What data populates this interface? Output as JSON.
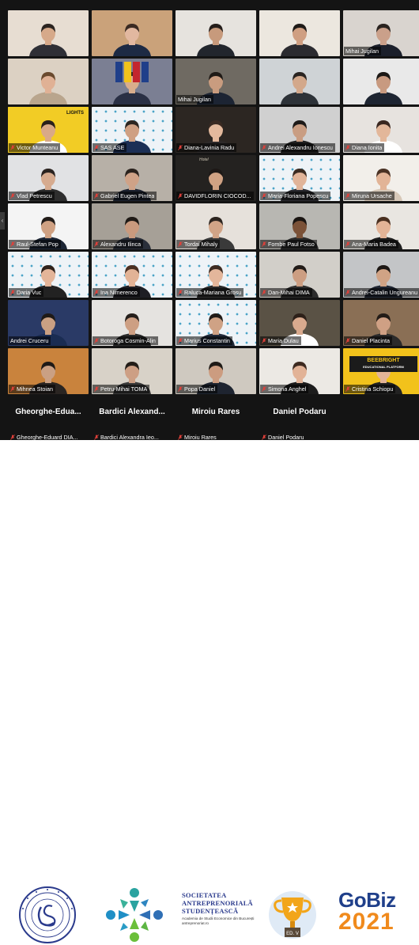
{
  "participants": [
    {
      "label": "",
      "bg": "#e7ddd2",
      "skin": "#d6a98a",
      "hair": "#2b2420",
      "shirt": "#2f2f36",
      "muted": false
    },
    {
      "label": "",
      "bg": "#caa27a",
      "skin": "#e2b8a0",
      "hair": "#3a2a22",
      "shirt": "#1d2a44",
      "muted": false
    },
    {
      "label": "",
      "bg": "#e6e3de",
      "skin": "#c79a7c",
      "hair": "#241d1a",
      "shirt": "#22262d",
      "muted": false
    },
    {
      "label": "",
      "bg": "#ece7df",
      "skin": "#cf9f82",
      "hair": "#1e1a17",
      "shirt": "#2b2b30",
      "muted": false
    },
    {
      "label": "Mihai Jugilan",
      "bg": "#d9d4cf",
      "skin": "#caa08a",
      "hair": "#2a2320",
      "shirt": "#1b1f2b",
      "muted": false
    },
    {
      "label": "",
      "bg": "#dcd1c3",
      "skin": "#e0b195",
      "hair": "#6a4a2e",
      "shirt": "#b9a58d",
      "muted": false
    },
    {
      "label": "",
      "bg": "#7b7f93",
      "skin": "#d9ad8c",
      "hair": "#3d2e23",
      "shirt": "#2a3045",
      "muted": false,
      "flags": true
    },
    {
      "label": "Mihai Jugilan",
      "bg": "#6f6a62",
      "skin": "#c99c7f",
      "hair": "#1f1a16",
      "shirt": "#1c2433",
      "muted": false
    },
    {
      "label": "",
      "bg": "#cfd3d6",
      "skin": "#d3a88b",
      "hair": "#2a2421",
      "shirt": "#2d3238",
      "muted": false
    },
    {
      "label": "",
      "bg": "#e9e9e9",
      "skin": "#c89a80",
      "hair": "#1b1815",
      "shirt": "#1e2532",
      "muted": false
    },
    {
      "label": "Victor Munteanu",
      "bg": "#f2cc25",
      "skin": "#d9a987",
      "hair": "#2a211b",
      "shirt": "#ffffff",
      "muted": true,
      "speaking": true
    },
    {
      "label": "SAS ASE",
      "bg": "#eef3f7",
      "skin": "#cfa083",
      "hair": "#2d2621",
      "shirt": "#1c2f55",
      "muted": true,
      "pattern": true
    },
    {
      "label": "Diana-Lavinia Radu",
      "bg": "#2c2622",
      "skin": "#e4b99d",
      "hair": "#3a2a22",
      "shirt": "#2e2a2a",
      "muted": true
    },
    {
      "label": "Andrei Alexandru Ionescu",
      "bg": "#d0d0d0",
      "skin": "#c99d82",
      "hair": "#1d1a18",
      "shirt": "#202020",
      "muted": true
    },
    {
      "label": "Diana Ionita",
      "bg": "#e7e3df",
      "skin": "#e3b79a",
      "hair": "#3a2720",
      "shirt": "#ffffff",
      "muted": true
    },
    {
      "label": "Vlad Petrescu",
      "bg": "#e1e2e4",
      "skin": "#d6ab8f",
      "hair": "#2a2320",
      "shirt": "#2e2e2e",
      "muted": true
    },
    {
      "label": "Gabriel Eugen Pintea",
      "bg": "#b7b0a7",
      "skin": "#cfa287",
      "hair": "#2a221d",
      "shirt": "#1c2230",
      "muted": true
    },
    {
      "label": "DAVIDFLORIN CIOCOD...",
      "bg": "#242220",
      "skin": "#d0a283",
      "hair": "#1d1816",
      "shirt": "#222222",
      "muted": true
    },
    {
      "label": "Maria-Floriana Popescu",
      "bg": "#eef3f7",
      "skin": "#e1b499",
      "hair": "#3b2b22",
      "shirt": "#2a2a30",
      "muted": true,
      "pattern": true
    },
    {
      "label": "Miruna Ursache",
      "bg": "#f2efea",
      "skin": "#e2b497",
      "hair": "#4a3224",
      "shirt": "#d7c8b8",
      "muted": true
    },
    {
      "label": "Raul-Stefan Pop",
      "bg": "#f4f4f4",
      "skin": "#cfa183",
      "hair": "#221c19",
      "shirt": "#1c2534",
      "muted": true
    },
    {
      "label": "Alexandru Ilinca",
      "bg": "#a6a097",
      "skin": "#c99a7e",
      "hair": "#1f1a16",
      "shirt": "#2a2f3a",
      "muted": true
    },
    {
      "label": "Tordai Mihaly",
      "bg": "#e6e1db",
      "skin": "#d1a487",
      "hair": "#2c241f",
      "shirt": "#3a3a3a",
      "muted": true
    },
    {
      "label": "Fombe Paul Fotso",
      "bg": "#b8b7b2",
      "skin": "#7b5238",
      "hair": "#1a1512",
      "shirt": "#2b2b2b",
      "muted": true
    },
    {
      "label": "Ana-Maria Badea",
      "bg": "#e9e6e1",
      "skin": "#e3b497",
      "hair": "#4a3020",
      "shirt": "#1f1f1f",
      "muted": true
    },
    {
      "label": "Daria Vuc",
      "bg": "#eef3f7",
      "skin": "#e3b599",
      "hair": "#2f221b",
      "shirt": "#222222",
      "muted": true,
      "pattern": true
    },
    {
      "label": "Ina Nimerenco",
      "bg": "#eef3f7",
      "skin": "#e2b396",
      "hair": "#4a3022",
      "shirt": "#1e1e24",
      "muted": true,
      "pattern": true
    },
    {
      "label": "Raluca-Mariana Grosu",
      "bg": "#eef3f7",
      "skin": "#e3b69b",
      "hair": "#3d2b21",
      "shirt": "#2a2a2a",
      "muted": true,
      "pattern": true
    },
    {
      "label": "Dan-Mihai DIMA",
      "bg": "#d2cfc9",
      "skin": "#cc9e82",
      "hair": "#221c18",
      "shirt": "#2c2c2c",
      "muted": true
    },
    {
      "label": "Andrei-Catalin Ungureanu",
      "bg": "#c3c5c7",
      "skin": "#d0a385",
      "hair": "#1d1815",
      "shirt": "#1f2633",
      "muted": true
    },
    {
      "label": "Andrei Cruceru",
      "bg": "#2a3a66",
      "skin": "#caa083",
      "hair": "#1f1a17",
      "shirt": "#1a2c52",
      "muted": false
    },
    {
      "label": "Botoroga Cosmin-Alin",
      "bg": "#e5e3e0",
      "skin": "#cd9f83",
      "hair": "#251f1b",
      "shirt": "#2a2a2a",
      "muted": true
    },
    {
      "label": "Marius Constantin",
      "bg": "#eef3f7",
      "skin": "#cfa285",
      "hair": "#211b18",
      "shirt": "#222a3a",
      "muted": true,
      "pattern": true
    },
    {
      "label": "Maria Dulau",
      "bg": "#5a5245",
      "skin": "#d9aa8e",
      "hair": "#2d2019",
      "shirt": "#ffffff",
      "muted": true
    },
    {
      "label": "Daniel Placinta",
      "bg": "#8a6f55",
      "skin": "#cfa084",
      "hair": "#231c17",
      "shirt": "#2b2b2b",
      "muted": true
    },
    {
      "label": "Mihnea Stoian",
      "bg": "#c9833d",
      "skin": "#caa083",
      "hair": "#1f1a16",
      "shirt": "#2a2522",
      "muted": true
    },
    {
      "label": "Petru-Mihai TOMA",
      "bg": "#d8d2c8",
      "skin": "#cd9f84",
      "hair": "#231d18",
      "shirt": "#3a3a3a",
      "muted": true
    },
    {
      "label": "Popa Daniel",
      "bg": "#cfc9c0",
      "skin": "#cc9c80",
      "hair": "#1f1a16",
      "shirt": "#1e2430",
      "muted": true
    },
    {
      "label": "Simona Anghel",
      "bg": "#ece9e4",
      "skin": "#e2b397",
      "hair": "#3d2a20",
      "shirt": "#1c1c1c",
      "muted": true
    },
    {
      "label": "Cristina Schiopu",
      "bg": "#f2c21b",
      "skin": "#e3b497",
      "hair": "#3a281f",
      "shirt": "#222222",
      "muted": true,
      "beebright": true
    }
  ],
  "name_tiles": [
    {
      "big": "Gheorghe-Edua...",
      "label": "Gheorghe-Eduard DIA..."
    },
    {
      "big": "Bardici Alexand...",
      "label": "Bardici Alexandra Ieo..."
    },
    {
      "big": "Miroiu Rares",
      "label": "Miroiu Rares"
    },
    {
      "big": "Daniel Podaru",
      "label": "Daniel Podaru"
    }
  ],
  "overlay_text": {
    "lights_sign": "LIGHTS",
    "hotel_sign": "Hotel",
    "beebright": "BEEBRIGHT",
    "beebright_sub": "EDUCATIONAL PLATFORM"
  },
  "logos": {
    "ssa_line1": "SOCIETATEA",
    "ssa_line2": "ANTREPRENORIALĂ",
    "ssa_line3": "STUDENȚEASCĂ",
    "ssa_small": "Academia de Studii Economice din București",
    "ssa_small2": "antreprenoriat.ro",
    "gobiz_top": "GoBiz",
    "gobiz_year": "2021",
    "trophy_tag": "ED. V"
  },
  "colors": {
    "grid_bg": "#141414",
    "speaking_border": "#f2d21b",
    "muted_icon": "#e0403a",
    "gobiz_blue": "#1f3f8a",
    "gobiz_orange": "#f08a1c"
  }
}
